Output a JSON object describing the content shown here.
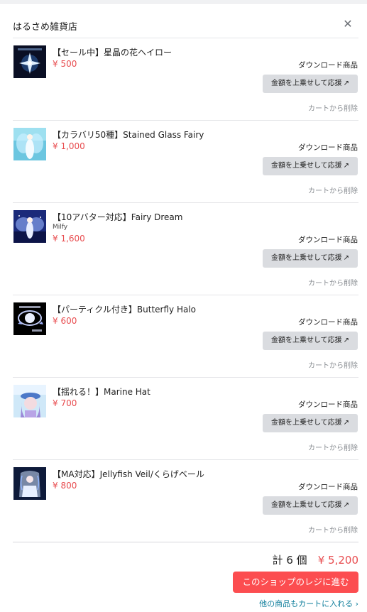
{
  "shop": {
    "name": "はるさめ雑貨店"
  },
  "icons": {
    "close": "close-icon",
    "boost_arrow": "external-link-arrow-icon",
    "more_chevron": "chevron-right-icon"
  },
  "colors": {
    "price": "#e84c4f",
    "checkout": "#fc4d50",
    "link": "#0d7d9b",
    "boost_bg": "#dadce0"
  },
  "cart": {
    "items": [
      {
        "title": "【セール中】星晶の花ヘイロー",
        "author": "",
        "price": "¥ 500",
        "type": "ダウンロード商品",
        "boost": "金額を上乗せして応援",
        "arrow": "↗",
        "remove": "カートから削除"
      },
      {
        "title": "【カラバリ50種】Stained Glass Fairy",
        "author": "",
        "price": "¥ 1,000",
        "type": "ダウンロード商品",
        "boost": "金額を上乗せして応援",
        "arrow": "↗",
        "remove": "カートから削除"
      },
      {
        "title": "【10アバター対応】Fairy Dream",
        "author": "Milfy",
        "price": "¥ 1,600",
        "type": "ダウンロード商品",
        "boost": "金額を上乗せして応援",
        "arrow": "↗",
        "remove": "カートから削除"
      },
      {
        "title": "【パーティクル付き】Butterfly Halo",
        "author": "",
        "price": "¥ 600",
        "type": "ダウンロード商品",
        "boost": "金額を上乗せして応援",
        "arrow": "↗",
        "remove": "カートから削除"
      },
      {
        "title": "【揺れる！】Marine Hat",
        "author": "",
        "price": "¥ 700",
        "type": "ダウンロード商品",
        "boost": "金額を上乗せして応援",
        "arrow": "↗",
        "remove": "カートから削除"
      },
      {
        "title": "【MA対応】Jellyfish Veil/くらげベール",
        "author": "",
        "price": "¥ 800",
        "type": "ダウンロード商品",
        "boost": "金額を上乗せして応援",
        "arrow": "↗",
        "remove": "カートから削除"
      }
    ]
  },
  "summary": {
    "count": "計 6 個",
    "total": "¥ 5,200"
  },
  "actions": {
    "checkout": "このショップのレジに進む",
    "more": "他の商品もカートに入れる",
    "more_chevron": "›"
  }
}
